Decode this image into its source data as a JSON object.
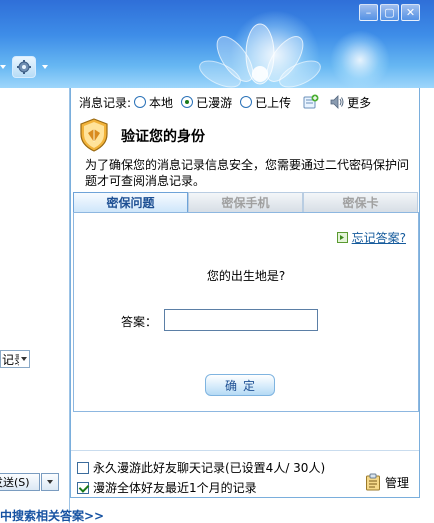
{
  "window": {
    "controls": [
      "minimize",
      "maximize",
      "close"
    ]
  },
  "record_bar": {
    "label": "消息记录:",
    "options": [
      {
        "label": "本地",
        "checked": false
      },
      {
        "label": "已漫游",
        "checked": true
      },
      {
        "label": "已上传",
        "checked": false
      }
    ],
    "more_label": "更多"
  },
  "verify": {
    "title": "验证您的身份",
    "description": "为了确保您的消息记录信息安全，您需要通过二代密码保护问题才可查阅消息记录。"
  },
  "tabs": [
    {
      "label": "密保问题",
      "active": true
    },
    {
      "label": "密保手机",
      "active": false
    },
    {
      "label": "密保卡",
      "active": false
    }
  ],
  "security_question": {
    "forgot_label": "忘记答案?",
    "question": "您的出生地是?",
    "answer_label": "答案：",
    "answer_value": "",
    "confirm_label": "确定"
  },
  "bottom": {
    "permanent_roam_label": "永久漫游此好友聊天记录(已设置4人/ 30人)",
    "permanent_roam_checked": false,
    "roam_all_label": "漫游全体好友最近1个月的记录",
    "roam_all_checked": true,
    "manage_label": "管理"
  },
  "left_fragments": {
    "record_select_text": "记录",
    "send_label": "发送(S)",
    "search_link": "中搜索相关答案>>"
  },
  "colors": {
    "banner": "#3e8de8",
    "accent_blue": "#1d4f93",
    "link": "#165b9c",
    "check_green": "#1a7a1a"
  }
}
